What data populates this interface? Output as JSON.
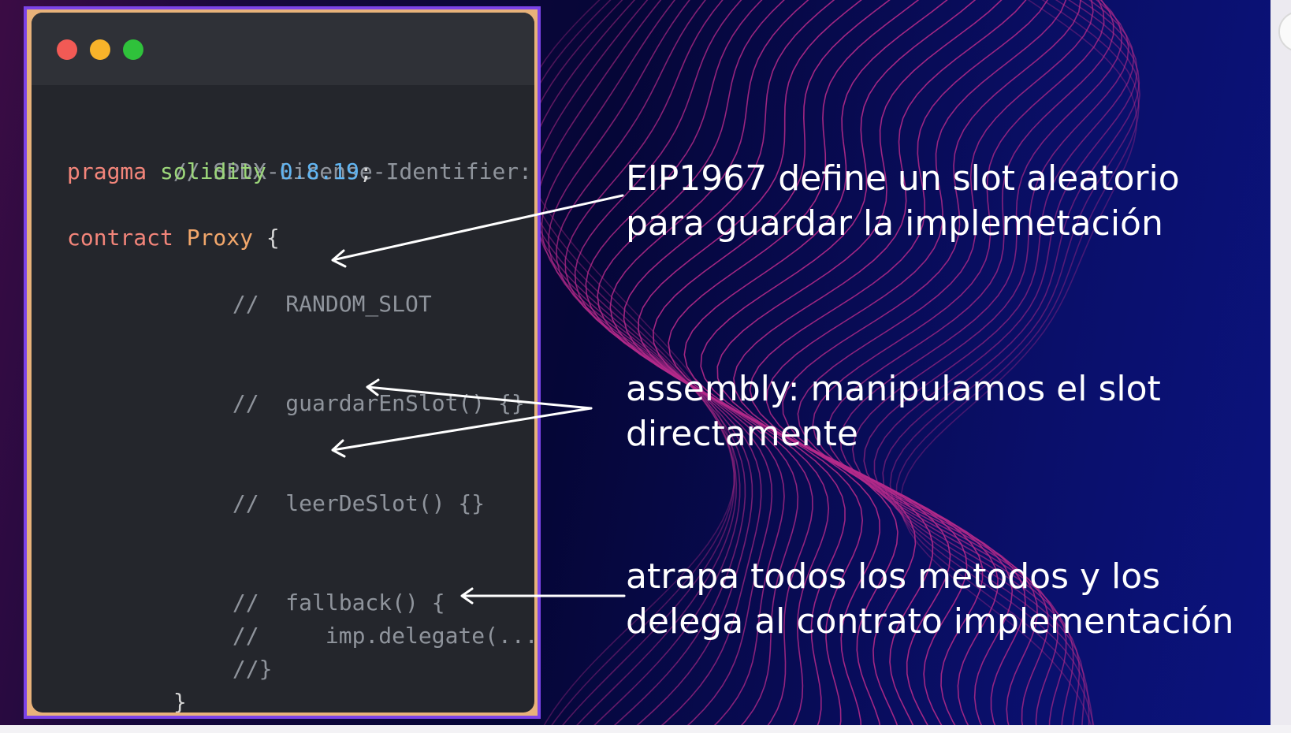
{
  "window": {
    "controls": [
      "close",
      "minimize",
      "maximize"
    ],
    "colors": {
      "close": "#f25a55",
      "minimize": "#f8b32a",
      "maximize": "#2fc23b"
    }
  },
  "code": {
    "license_comment": "// SPDX-License-Identifier: MIT",
    "pragma_keyword": "pragma",
    "pragma_name": "solidity",
    "pragma_version": "0.8.19",
    "pragma_end": ";",
    "contract_keyword": "contract",
    "contract_name": "Proxy",
    "contract_open": "{",
    "random_slot_comment": "//  RANDOM_SLOT",
    "guardar_comment": "//  guardarEnSlot() {}",
    "leer_comment": "//  leerDeSlot() {}",
    "fallback_comment": "//  fallback() {",
    "delegate_comment": "//     imp.delegate(...)",
    "fallback_close_comment": "//}",
    "contract_close": "}"
  },
  "annotations": {
    "eip1967": [
      "EIP1967 define un slot aleatorio",
      "para guardar la implemetación"
    ],
    "assembly": [
      "assembly: manipulamos el slot",
      "directamente"
    ],
    "fallback": [
      "atrapa todos los metodos y los",
      "delega al contrato implementación"
    ]
  },
  "colors": {
    "frame_border": "#7c43e8",
    "editor_background": "#24262c",
    "wave": "#b52a8a",
    "slide_background": "#050637"
  }
}
